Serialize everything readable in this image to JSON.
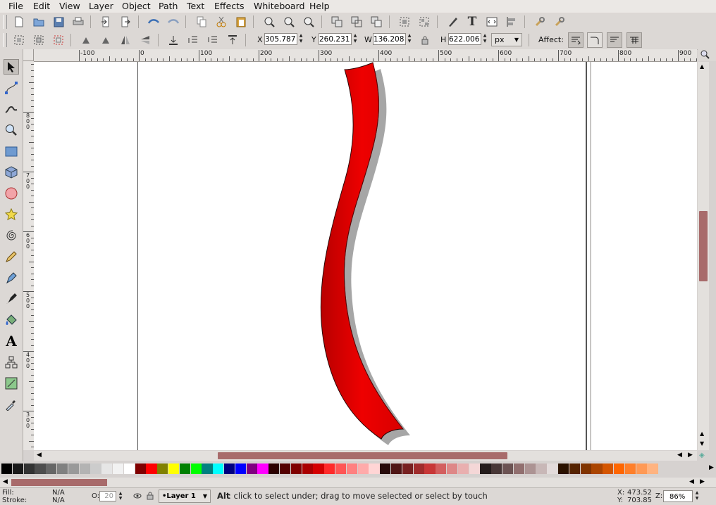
{
  "menu": {
    "file": "File",
    "edit": "Edit",
    "view": "View",
    "layer": "Layer",
    "object": "Object",
    "path": "Path",
    "text": "Text",
    "effects": "Effects",
    "whiteboard": "Whiteboard",
    "help": "Help"
  },
  "toolbar": {
    "x_label": "X",
    "x_value": "305.787",
    "y_label": "Y",
    "y_value": "260.231",
    "w_label": "W",
    "w_value": "136.208",
    "h_label": "H",
    "h_value": "622.006",
    "unit": "px",
    "affect_label": "Affect:"
  },
  "rulers": {
    "h_labels": [
      "-100",
      "0",
      "100",
      "200",
      "300",
      "400",
      "500",
      "600",
      "700",
      "800",
      "900"
    ],
    "v_labels": [
      "800",
      "700",
      "600",
      "500",
      "400",
      "300"
    ]
  },
  "status": {
    "fill_label": "Fill:",
    "fill_value": "N/A",
    "stroke_label": "Stroke:",
    "stroke_value": "N/A",
    "opacity_label": "O:",
    "opacity_value": "20",
    "layer": "•Layer 1",
    "message_bold": "Alt",
    "message": ": click to select under; drag to move selected or select by touch",
    "x_label": "X:",
    "x_value": "473.52",
    "y_label": "Y:",
    "y_value": "703.85",
    "zoom_label": "Z:",
    "zoom_value": "86%"
  },
  "palette_colors": [
    "#000000",
    "#1a1a1a",
    "#333333",
    "#4d4d4d",
    "#666666",
    "#808080",
    "#999999",
    "#b3b3b3",
    "#cccccc",
    "#e6e6e6",
    "#f2f2f2",
    "#ffffff",
    "#800000",
    "#ff0000",
    "#808000",
    "#ffff00",
    "#008000",
    "#00ff00",
    "#008080",
    "#00ffff",
    "#000080",
    "#0000ff",
    "#800080",
    "#ff00ff",
    "#2b0000",
    "#550000",
    "#800000",
    "#aa0000",
    "#d40000",
    "#ff2a2a",
    "#ff5555",
    "#ff8080",
    "#ffaaaa",
    "#ffd5d5",
    "#280b0b",
    "#501616",
    "#782121",
    "#a02c2c",
    "#c83737",
    "#d35f5f",
    "#de8787",
    "#e9afaf",
    "#f4d7d7",
    "#241c1c",
    "#483737",
    "#6c5353",
    "#916f6f",
    "#ac9393",
    "#c8b7b7",
    "#e3dbdb",
    "#2b1100",
    "#552200",
    "#803300",
    "#aa4400",
    "#d45500",
    "#ff6600",
    "#ff7f2a",
    "#ff9955",
    "#ffb380"
  ],
  "colors": {
    "shape_fill": "#ee0000",
    "shape_dark": "#c80000",
    "shape_stroke": "#2a0000",
    "selection_scroll": "#a86b6b"
  }
}
